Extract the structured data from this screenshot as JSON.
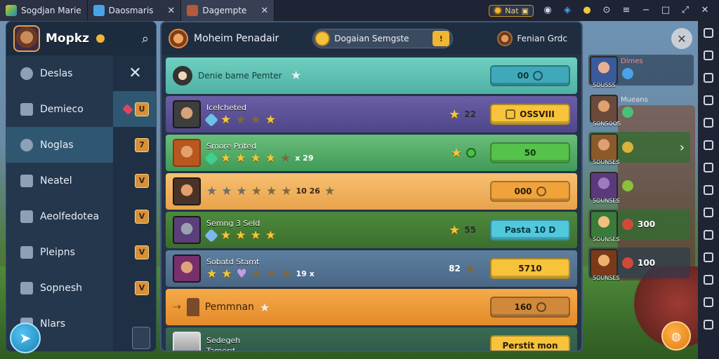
{
  "titlebar": {
    "tabs": [
      {
        "label": "Sogdjan Marie",
        "icon": "app-icon"
      },
      {
        "label": "Daosmaris",
        "icon": "cloud-icon"
      },
      {
        "label": "Dagempte",
        "icon": "game-icon"
      }
    ],
    "coin_value": "Nat",
    "colors": {
      "bg": "#1e2433",
      "coin": "#f0b632"
    }
  },
  "left_panel": {
    "title": "Mopkz",
    "menu": [
      {
        "label": "Deslas",
        "icon": "circle-icon"
      },
      {
        "label": "Demieco",
        "icon": "house-icon"
      },
      {
        "label": "Noglas",
        "icon": "person-icon"
      },
      {
        "label": "Neatel",
        "icon": "inbox-icon"
      },
      {
        "label": "Aeolfedotea",
        "icon": "store-icon"
      },
      {
        "label": "Pleipns",
        "icon": "square-icon"
      },
      {
        "label": "Sopnesh",
        "icon": "gift-icon"
      },
      {
        "label": "Nlars",
        "icon": "chat-icon"
      }
    ],
    "badges": [
      "U",
      "7",
      "V",
      "V",
      "V",
      "V"
    ],
    "active_index": 2
  },
  "main_panel": {
    "header_title": "Moheim Penadair",
    "pill_text": "Dogaian Semgste",
    "pill_button": "!",
    "right_label": "Fenian Grdc",
    "rows": [
      {
        "name": "Denie bame Pemter",
        "button": "00",
        "style": "teal"
      },
      {
        "name": "Icelcheted",
        "count": "",
        "mid": "22",
        "button": "OSSVIII",
        "style": "purple"
      },
      {
        "name": "Smore Prited",
        "count": "x 29",
        "mid": "",
        "button": "50",
        "style": "green"
      },
      {
        "name": "",
        "count": "10 26",
        "mid": "",
        "button": "000",
        "style": "orange"
      },
      {
        "name": "Semng 3 Seld",
        "count": "",
        "mid": "55",
        "button": "Pasta 10 D",
        "style": "dgreen"
      },
      {
        "name": "Sobatd Stamt",
        "count": "19 x",
        "mid": "82",
        "button": "5710",
        "style": "blue"
      },
      {
        "name": "Pemmnan",
        "count": "",
        "mid": "",
        "button": "160",
        "style": "orange2"
      },
      {
        "name": "Sedegeh",
        "name2": "Tamerd",
        "button": "Perstit mon",
        "style": "dark"
      }
    ]
  },
  "hero_column": [
    {
      "label": "SOUSSS",
      "tag": "Dimes",
      "value": ""
    },
    {
      "label": "SONSOOS",
      "tag": "Mueans",
      "value": ""
    },
    {
      "label": "SOUNSES",
      "tag": "",
      "value": ""
    },
    {
      "label": "SOUNSES",
      "tag": "",
      "value": ""
    },
    {
      "label": "SOUNSES",
      "tag": "",
      "value": "300"
    },
    {
      "label": "SOUNSES",
      "tag": "",
      "value": "100"
    }
  ]
}
